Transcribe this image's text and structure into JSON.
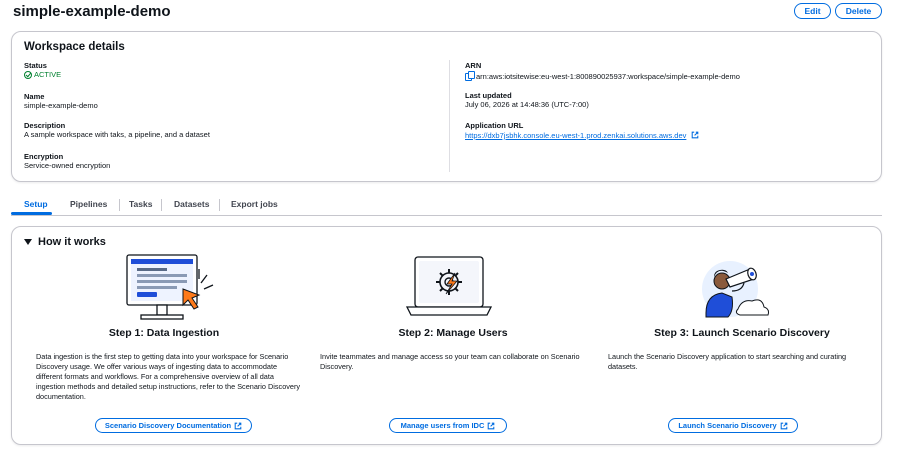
{
  "header": {
    "title": "simple-example-demo",
    "edit_label": "Edit",
    "delete_label": "Delete"
  },
  "details": {
    "title": "Workspace details",
    "status_label": "Status",
    "status_value": "ACTIVE",
    "name_label": "Name",
    "name_value": "simple-example-demo",
    "description_label": "Description",
    "description_value": "A sample workspace with taks, a pipeline, and a dataset",
    "encryption_label": "Encryption",
    "encryption_value": "Service-owned encryption",
    "arn_label": "ARN",
    "arn_value": "arn:aws:iotsitewise:eu-west-1:800890025937:workspace/simple-example-demo",
    "updated_label": "Last updated",
    "updated_value": "July 06, 2026 at 14:48:36 (UTC-7:00)",
    "url_label": "Application URL",
    "url_value": "https://dxb7jsbhk.console.eu-west-1.prod.zenkai.solutions.aws.dev"
  },
  "tabs": [
    {
      "label": "Setup"
    },
    {
      "label": "Pipelines"
    },
    {
      "label": "Tasks"
    },
    {
      "label": "Datasets"
    },
    {
      "label": "Export jobs"
    }
  ],
  "how_it_works": {
    "title": "How it works",
    "steps": [
      {
        "title": "Step 1: Data Ingestion",
        "description": "Data ingestion is the first step to getting data into your workspace for Scenario Discovery usage. We offer various ways of ingesting data to accommodate different formats and workflows. For a comprehensive overview of all data ingestion methods and detailed setup instructions, refer to the Scenario Discovery documentation.",
        "button": "Scenario Discovery Documentation"
      },
      {
        "title": "Step 2: Manage Users",
        "description": "Invite teammates and manage access so your team can collaborate on Scenario Discovery.",
        "button": "Manage users from IDC"
      },
      {
        "title": "Step 3: Launch Scenario Discovery",
        "description": "Launch the Scenario Discovery application to start searching and curating datasets.",
        "button": "Launch Scenario Discovery"
      }
    ]
  },
  "colors": {
    "accent": "#006ce0",
    "success": "#00802f",
    "illus_orange": "#ff7a1a",
    "illus_blue": "#1f4ed8"
  }
}
